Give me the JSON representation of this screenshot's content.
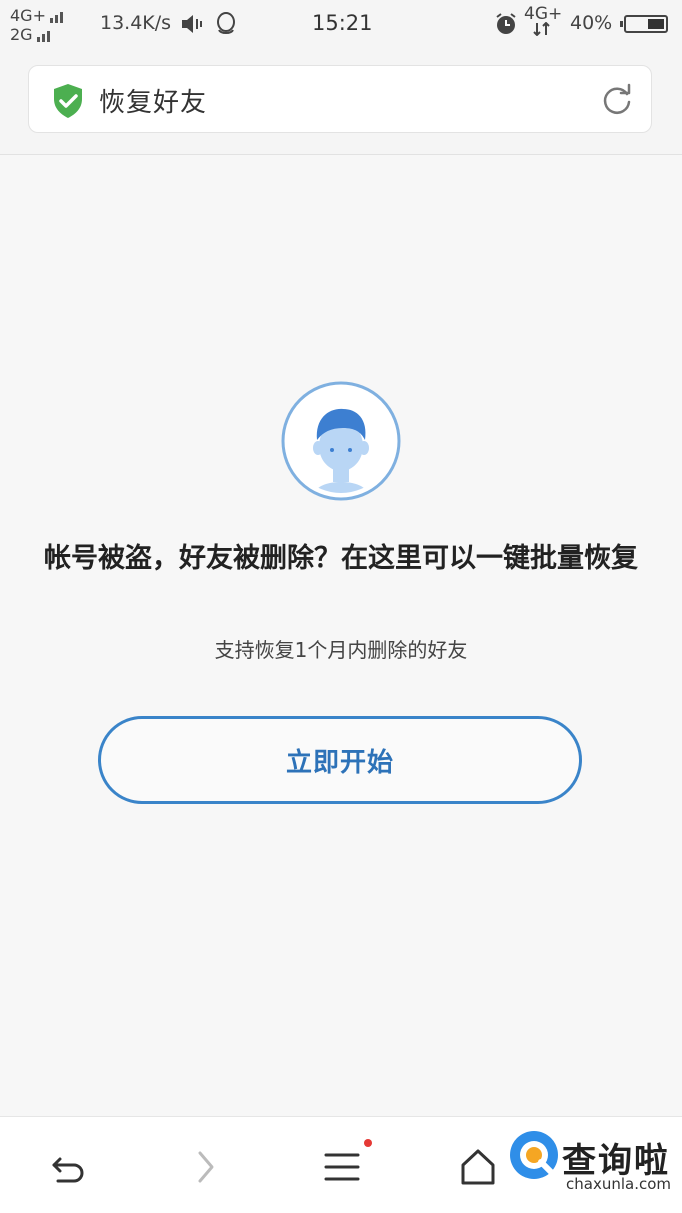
{
  "status_bar": {
    "net_top": "4G+",
    "net_bottom": "2G",
    "speed": "13.4K/s",
    "time": "15:21",
    "net_right": "4G+",
    "battery": "40%",
    "battery_level": 0.4,
    "icons": [
      "volume-vibrate-icon",
      "qq-icon",
      "alarm-clock-icon",
      "data-arrows-icon"
    ]
  },
  "header": {
    "title": "恢复好友",
    "secure_icon": "shield-check-icon",
    "reload_icon": "reload-icon",
    "accent": "#4caf50"
  },
  "main": {
    "avatar_icon": "user-avatar-icon",
    "headline": "帐号被盗，好友被删除？在这里可以一键批量恢复",
    "subline": "支持恢复1个月内删除的好友",
    "start_button": "立即开始",
    "accent": "#3a84c9"
  },
  "bottom_nav": {
    "items": [
      "back-icon",
      "forward-icon",
      "menu-icon",
      "home-icon"
    ],
    "menu_badge_color": "#e53935"
  },
  "watermark": {
    "name": "查询啦",
    "domain": "chaxunla.com"
  }
}
